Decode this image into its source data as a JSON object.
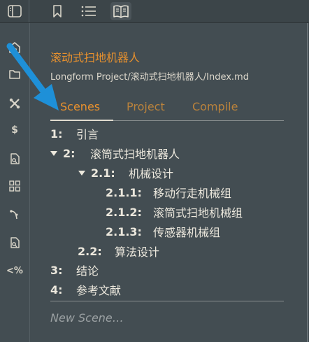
{
  "topbar": {
    "icons": [
      "sidebar-toggle-icon",
      "bookmark-icon",
      "list-icon",
      "book-icon"
    ]
  },
  "ribbon": {
    "icons": [
      "home-icon",
      "folder-icon",
      "tools-icon",
      "dollar-icon",
      "search-file-icon",
      "grid-icon",
      "branch-icon",
      "search-file-icon-2",
      "percent-icon"
    ],
    "dollar_glyph": "$",
    "percent_glyph": "<%"
  },
  "project": {
    "title": "滚动式扫地机器人",
    "path": "Longform Project/滚动式扫地机器人/Index.md"
  },
  "tabs": [
    {
      "label": "Scenes",
      "active": true
    },
    {
      "label": "Project",
      "active": false
    },
    {
      "label": "Compile",
      "active": false
    }
  ],
  "scenes": [
    {
      "num": "1:",
      "title": "引言"
    },
    {
      "num": "2:",
      "title": "滚筒式扫地机器人"
    },
    {
      "num": "2.1:",
      "title": "机械设计"
    },
    {
      "num": "2.1.1:",
      "title": "移动行走机械组"
    },
    {
      "num": "2.1.2:",
      "title": "滚筒式扫地机械组"
    },
    {
      "num": "2.1.3:",
      "title": "传感器机械组"
    },
    {
      "num": "2.2:",
      "title": "算法设计"
    },
    {
      "num": "3:",
      "title": "结论"
    },
    {
      "num": "4:",
      "title": "参考文献"
    }
  ],
  "new_scene_placeholder": "New Scene…",
  "colors": {
    "accent": "#e8912e",
    "arrow": "#1e90d8"
  }
}
